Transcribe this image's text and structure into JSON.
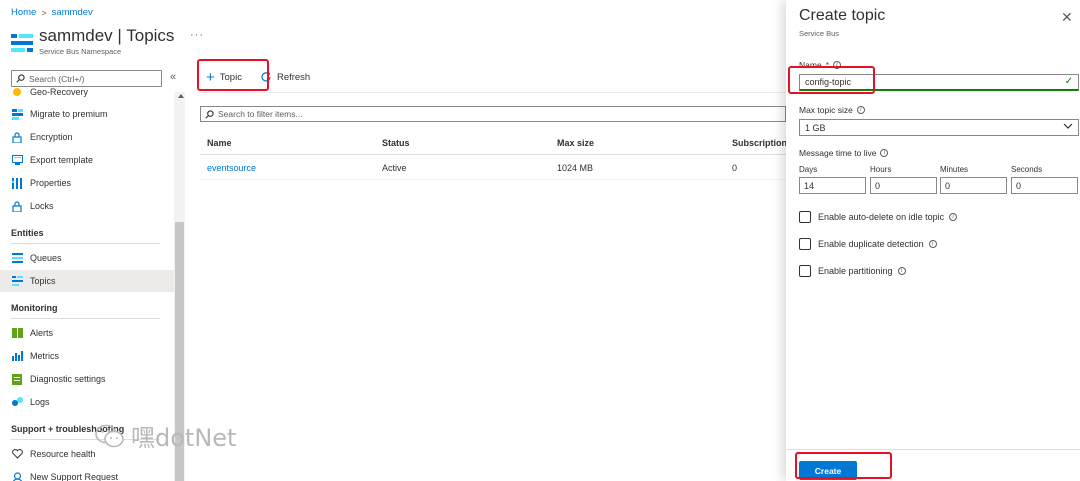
{
  "breadcrumb": {
    "home": "Home",
    "separator": ">",
    "current": "sammdev"
  },
  "header": {
    "title": "sammdev | Topics",
    "subtitle": "Service Bus Namespace",
    "more": "···"
  },
  "sidebar": {
    "search_placeholder": "Search (Ctrl+/)",
    "collapse": "«",
    "items": [
      {
        "label": "Geo-Recovery",
        "icon": "geo-recovery-icon"
      },
      {
        "label": "Migrate to premium",
        "icon": "migrate-icon"
      },
      {
        "label": "Encryption",
        "icon": "lock-icon"
      },
      {
        "label": "Export template",
        "icon": "export-template-icon"
      },
      {
        "label": "Properties",
        "icon": "properties-icon"
      },
      {
        "label": "Locks",
        "icon": "lock-icon"
      }
    ],
    "entities": {
      "heading": "Entities",
      "items": [
        {
          "label": "Queues",
          "icon": "queues-icon"
        },
        {
          "label": "Topics",
          "icon": "topics-icon"
        }
      ]
    },
    "monitoring": {
      "heading": "Monitoring",
      "items": [
        {
          "label": "Alerts",
          "icon": "alerts-icon"
        },
        {
          "label": "Metrics",
          "icon": "metrics-icon"
        },
        {
          "label": "Diagnostic settings",
          "icon": "diagnostic-settings-icon"
        },
        {
          "label": "Logs",
          "icon": "logs-icon"
        }
      ]
    },
    "support": {
      "heading": "Support + troubleshooting",
      "items": [
        {
          "label": "Resource health",
          "icon": "heart-icon"
        },
        {
          "label": "New Support Request",
          "icon": "support-icon"
        }
      ]
    }
  },
  "toolbar": {
    "add_topic": "Topic",
    "refresh": "Refresh"
  },
  "filter": {
    "placeholder": "Search to filter items..."
  },
  "table": {
    "columns": [
      "Name",
      "Status",
      "Max size",
      "Subscription"
    ],
    "rows": [
      {
        "name": "eventsource",
        "status": "Active",
        "max_size": "1024 MB",
        "subscriptions": "0"
      }
    ]
  },
  "panel": {
    "title": "Create topic",
    "subtitle": "Service Bus",
    "close": "✕",
    "name_label": "Name",
    "required_mark": "*",
    "name_value": "config-topic",
    "max_size_label": "Max topic size",
    "max_size_value": "1 GB",
    "ttl_label": "Message time to live",
    "ttl": {
      "days_label": "Days",
      "days": "14",
      "hours_label": "Hours",
      "hours": "0",
      "minutes_label": "Minutes",
      "minutes": "0",
      "seconds_label": "Seconds",
      "seconds": "0"
    },
    "options": [
      "Enable auto-delete on idle topic",
      "Enable duplicate detection",
      "Enable partitioning"
    ],
    "create_button": "Create"
  },
  "watermark": "嘿dotNet",
  "colors": {
    "accent": "#0078d4",
    "highlight": "#e81123",
    "valid": "#107c10"
  }
}
